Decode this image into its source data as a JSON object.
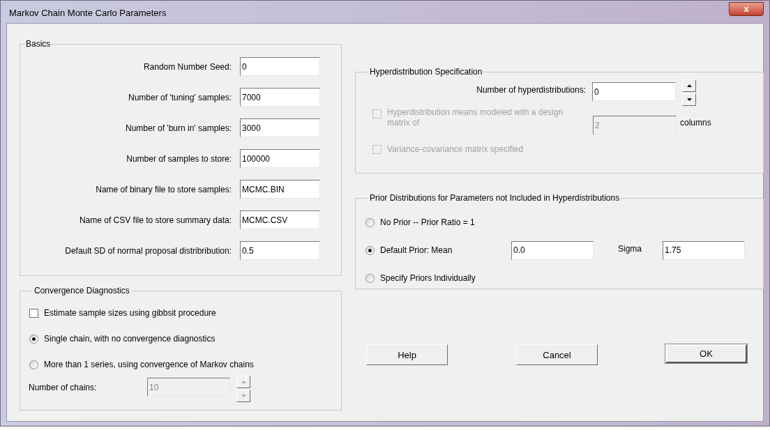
{
  "window": {
    "title": "Markov Chain Monte Carlo Parameters",
    "close": "x"
  },
  "basics": {
    "title": "Basics",
    "fields": [
      {
        "label": "Random Number Seed:",
        "value": "0"
      },
      {
        "label": "Number of 'tuning' samples:",
        "value": "7000"
      },
      {
        "label": "Number of 'burn in' samples:",
        "value": "3000"
      },
      {
        "label": "Number of samples to store:",
        "value": "100000"
      },
      {
        "label": "Name of binary file to store samples:",
        "value": "MCMC.BIN"
      },
      {
        "label": "Name of CSV file to store summary data:",
        "value": "MCMC.CSV"
      },
      {
        "label": "Default SD of normal proposal distribribution:",
        "value": "0.5"
      }
    ]
  },
  "convergence": {
    "title": "Convergence Diagnostics",
    "options": [
      {
        "kind": "checkbox",
        "label": "Estimate sample sizes using gibbsit procedure",
        "checked": false
      },
      {
        "kind": "radio",
        "label": "Single chain, with no convergence diagnostics",
        "selected": true
      },
      {
        "kind": "radio",
        "label": "More than 1 series, using convergence of Markov chains",
        "selected": false
      }
    ],
    "chains": {
      "label": "Number of chains:",
      "value": "10",
      "disabled": true
    }
  },
  "hyperdistribution": {
    "title": "Hyperdistribution Specification",
    "count": {
      "label": "Number of hyperdistributions:",
      "value": "0",
      "disabled": false
    },
    "design": {
      "label": "Hyperdistribution means modeled with a design matrix of",
      "checked": false,
      "disabled": true,
      "value": "2",
      "unit": "columns"
    },
    "varcov": {
      "label": "Variance-covariance matrix specified",
      "checked": false,
      "disabled": true
    }
  },
  "priors": {
    "title": "Prior Distributions for Parameters not Included in Hyperdistributions",
    "options": [
      {
        "label": "No Prior -- Prior Ratio = 1",
        "selected": false
      },
      {
        "label": "Default Prior: Mean",
        "selected": true,
        "mean": "0.0",
        "sigma_label": "Sigma",
        "sigma": "1.75"
      },
      {
        "label": "Specify Priors Individually",
        "selected": false
      }
    ]
  },
  "buttons": [
    {
      "label": "Help",
      "default": false
    },
    {
      "label": "Cancel",
      "default": false
    },
    {
      "label": "OK",
      "default": true
    }
  ]
}
